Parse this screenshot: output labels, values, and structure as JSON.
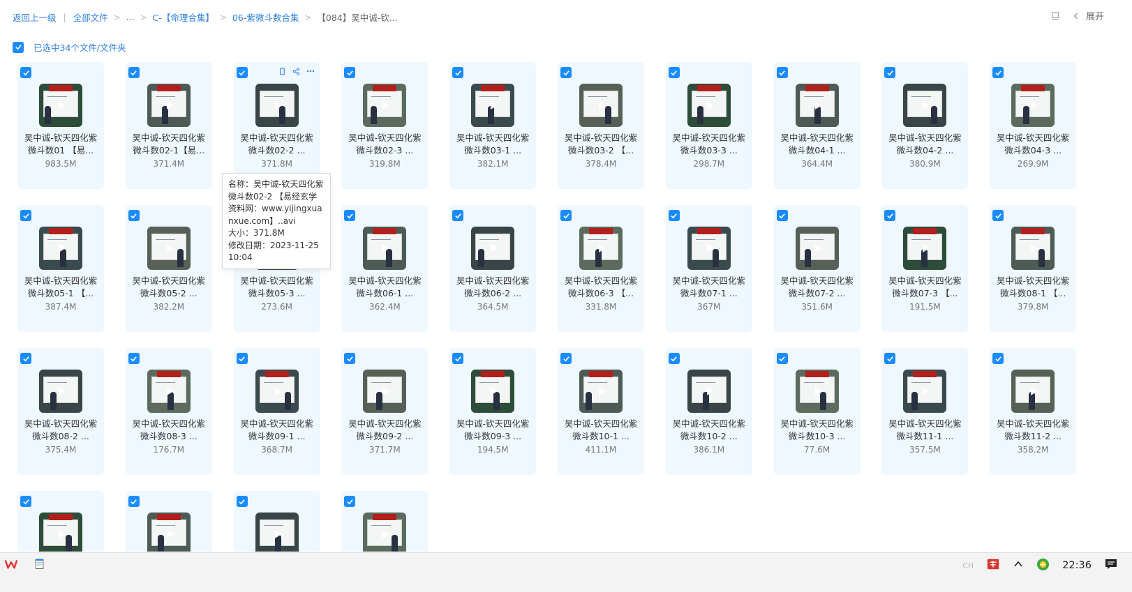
{
  "breadcrumb": {
    "back": "返回上一级",
    "all_files": "全部文件",
    "ellipsis": "...",
    "folder1": "C-【命理合集】",
    "folder2": "06-紫微斗数合集",
    "current": "【084】吴中诚-钦..."
  },
  "toolbar": {
    "expand_label": "展开"
  },
  "selection": {
    "label": "已选中34个文件/文件夹"
  },
  "colors": {
    "accent": "#1a8cff",
    "card_bg": "#eef8fe",
    "link": "#2d7fe6"
  },
  "files": [
    {
      "line1": "吴中诚-钦天四化紫",
      "line2": "微斗数01 【易...",
      "size": "983.5M"
    },
    {
      "line1": "吴中诚-钦天四化紫",
      "line2": "微斗数02-1【易...",
      "size": "371.4M"
    },
    {
      "line1": "吴中诚-钦天四化紫",
      "line2": "微斗数02-2 ...",
      "size": "371.8M"
    },
    {
      "line1": "吴中诚-钦天四化紫",
      "line2": "微斗数02-3 ...",
      "size": "319.8M"
    },
    {
      "line1": "吴中诚-钦天四化紫",
      "line2": "微斗数03-1 ...",
      "size": "382.1M"
    },
    {
      "line1": "吴中诚-钦天四化紫",
      "line2": "微斗数03-2 【...",
      "size": "378.4M"
    },
    {
      "line1": "吴中诚-钦天四化紫",
      "line2": "微斗数03-3 ...",
      "size": "298.7M"
    },
    {
      "line1": "吴中诚-钦天四化紫",
      "line2": "微斗数04-1 ...",
      "size": "364.4M"
    },
    {
      "line1": "吴中诚-钦天四化紫",
      "line2": "微斗数04-2 ...",
      "size": "380.9M"
    },
    {
      "line1": "吴中诚-钦天四化紫",
      "line2": "微斗数04-3 ...",
      "size": "269.9M"
    },
    {
      "line1": "吴中诚-钦天四化紫",
      "line2": "微斗数05-1 【...",
      "size": "387.4M"
    },
    {
      "line1": "吴中诚-钦天四化紫",
      "line2": "微斗数05-2 ...",
      "size": "382.2M"
    },
    {
      "line1": "吴中诚-钦天四化紫",
      "line2": "微斗数05-3 ...",
      "size": "273.6M"
    },
    {
      "line1": "吴中诚-钦天四化紫",
      "line2": "微斗数06-1 ...",
      "size": "362.4M"
    },
    {
      "line1": "吴中诚-钦天四化紫",
      "line2": "微斗数06-2 ...",
      "size": "364.5M"
    },
    {
      "line1": "吴中诚-钦天四化紫",
      "line2": "微斗数06-3 【...",
      "size": "331.8M"
    },
    {
      "line1": "吴中诚-钦天四化紫",
      "line2": "微斗数07-1 ...",
      "size": "367M"
    },
    {
      "line1": "吴中诚-钦天四化紫",
      "line2": "微斗数07-2 ...",
      "size": "351.6M"
    },
    {
      "line1": "吴中诚-钦天四化紫",
      "line2": "微斗数07-3 【...",
      "size": "191.5M"
    },
    {
      "line1": "吴中诚-钦天四化紫",
      "line2": "微斗数08-1 【...",
      "size": "379.8M"
    },
    {
      "line1": "吴中诚-钦天四化紫",
      "line2": "微斗数08-2 ...",
      "size": "375.4M"
    },
    {
      "line1": "吴中诚-钦天四化紫",
      "line2": "微斗数08-3 ...",
      "size": "176.7M"
    },
    {
      "line1": "吴中诚-钦天四化紫",
      "line2": "微斗数09-1 ...",
      "size": "368.7M"
    },
    {
      "line1": "吴中诚-钦天四化紫",
      "line2": "微斗数09-2 ...",
      "size": "371.7M"
    },
    {
      "line1": "吴中诚-钦天四化紫",
      "line2": "微斗数09-3 ...",
      "size": "194.5M"
    },
    {
      "line1": "吴中诚-钦天四化紫",
      "line2": "微斗数10-1 ...",
      "size": "411.1M"
    },
    {
      "line1": "吴中诚-钦天四化紫",
      "line2": "微斗数10-2 ...",
      "size": "386.1M"
    },
    {
      "line1": "吴中诚-钦天四化紫",
      "line2": "微斗数10-3 ...",
      "size": "77.6M"
    },
    {
      "line1": "吴中诚-钦天四化紫",
      "line2": "微斗数11-1 ...",
      "size": "357.5M"
    },
    {
      "line1": "吴中诚-钦天四化紫",
      "line2": "微斗数11-2 ...",
      "size": "358.2M"
    },
    {
      "line1": "",
      "line2": "",
      "size": ""
    },
    {
      "line1": "",
      "line2": "",
      "size": ""
    },
    {
      "line1": "",
      "line2": "",
      "size": ""
    },
    {
      "line1": "",
      "line2": "",
      "size": ""
    }
  ],
  "tooltip": {
    "name": "名称：吴中诚-钦天四化紫微斗数02-2 【易经玄学资料网：www.yijingxuanxue.com】..avi",
    "size": "大小：371.8M",
    "modified": "修改日期：2023-11-25 10:04"
  },
  "taskbar": {
    "clock": "22:36",
    "ime": "CH"
  }
}
